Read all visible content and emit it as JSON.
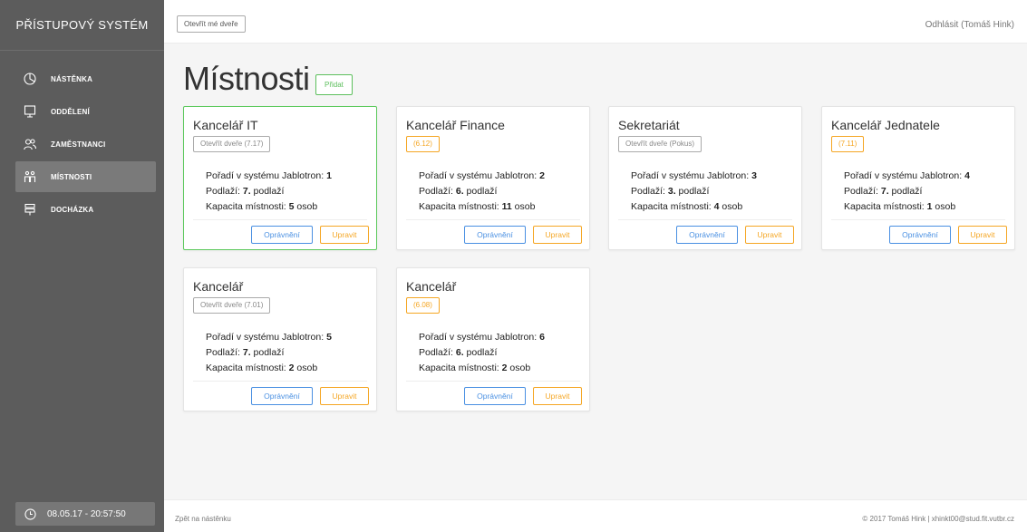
{
  "brand": "PŘÍSTUPOVÝ SYSTÉM",
  "nav": [
    {
      "label": "NÁSTĚNKA",
      "icon": "pie-chart-icon"
    },
    {
      "label": "ODDĚLENÍ",
      "icon": "monitor-icon"
    },
    {
      "label": "ZAMĚSTNANCI",
      "icon": "users-icon"
    },
    {
      "label": "MÍSTNOSTI",
      "icon": "rooms-icon",
      "active": true
    },
    {
      "label": "DOCHÁZKA",
      "icon": "signpost-icon"
    }
  ],
  "clock": "08.05.17 - 20:57:50",
  "topbar": {
    "open_door_label": "Otevřít mé dveře",
    "logout_label": "Odhlásit (Tomáš Hink)"
  },
  "main": {
    "title": "Místnosti",
    "add_label": "Přidat"
  },
  "card_labels": {
    "order_prefix": "Pořadí v systému Jablotron: ",
    "floor_prefix": "Podlaží: ",
    "floor_suffix": " podlaží",
    "capacity_prefix": "Kapacita místnosti: ",
    "capacity_suffix": " osob",
    "perm_label": "Oprávnění",
    "edit_label": "Upravit"
  },
  "rooms": [
    {
      "name": "Kancelář IT",
      "tag": "Otevřít dveře (7.17)",
      "tag_style": "grey",
      "order": "1",
      "floor": "7.",
      "capacity": "5",
      "highlight": true
    },
    {
      "name": "Kancelář Finance",
      "tag": "(6.12)",
      "tag_style": "orange",
      "order": "2",
      "floor": "6.",
      "capacity": "11"
    },
    {
      "name": "Sekretariát",
      "tag": "Otevřít dveře (Pokus)",
      "tag_style": "grey",
      "order": "3",
      "floor": "3.",
      "capacity": "4"
    },
    {
      "name": "Kancelář Jednatele",
      "tag": "(7.11)",
      "tag_style": "orange",
      "order": "4",
      "floor": "7.",
      "capacity": "1"
    },
    {
      "name": "Kancelář",
      "tag": "Otevřít dveře (7.01)",
      "tag_style": "grey",
      "order": "5",
      "floor": "7.",
      "capacity": "2"
    },
    {
      "name": "Kancelář",
      "tag": "(6.08)",
      "tag_style": "orange",
      "order": "6",
      "floor": "6.",
      "capacity": "2"
    }
  ],
  "footer": {
    "back_label": "Zpět na nástěnku",
    "copyright": "© 2017 Tomáš Hink | xhinkt00@stud.fit.vutbr.cz"
  },
  "colors": {
    "sidebar": "#5c5c5c",
    "accent_green": "#5cbf5c",
    "accent_orange": "#f5a623",
    "accent_blue": "#4a90e2"
  }
}
